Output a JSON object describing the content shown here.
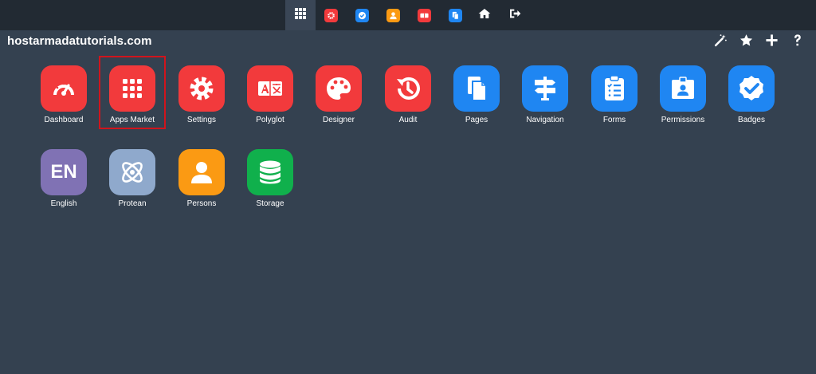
{
  "site_title": "hostarmadatutorials.com",
  "colors": {
    "red": "#f23a3c",
    "blue": "#1f86f2",
    "orange": "#fb9a13",
    "purple": "#8072b4",
    "lightblue": "#8fa9cc",
    "green": "#10b04c",
    "highlight": "#d0141c"
  },
  "topbar": {
    "items": [
      {
        "icon": "grid-icon"
      },
      {
        "icon": "settings-icon"
      },
      {
        "icon": "badge-check-icon"
      },
      {
        "icon": "person-icon"
      },
      {
        "icon": "polyglot-icon"
      },
      {
        "icon": "pages-icon"
      },
      {
        "icon": "home-icon"
      },
      {
        "icon": "logout-icon"
      }
    ]
  },
  "toolbar": {
    "items": [
      {
        "icon": "magic-wand-icon"
      },
      {
        "icon": "star-icon"
      },
      {
        "icon": "plus-icon"
      },
      {
        "icon": "help-icon"
      }
    ]
  },
  "apps": [
    {
      "label": "Dashboard",
      "icon": "dashboard-gauge-icon",
      "color": "red"
    },
    {
      "label": "Apps Market",
      "icon": "apps-grid-icon",
      "color": "red",
      "selected": true
    },
    {
      "label": "Settings",
      "icon": "gear-icon",
      "color": "red"
    },
    {
      "label": "Polyglot",
      "icon": "translate-icon",
      "color": "red"
    },
    {
      "label": "Designer",
      "icon": "palette-icon",
      "color": "red"
    },
    {
      "label": "Audit",
      "icon": "history-icon",
      "color": "red"
    },
    {
      "label": "Pages",
      "icon": "pages-icon",
      "color": "blue"
    },
    {
      "label": "Navigation",
      "icon": "signpost-icon",
      "color": "blue"
    },
    {
      "label": "Forms",
      "icon": "clipboard-list-icon",
      "color": "blue"
    },
    {
      "label": "Permissions",
      "icon": "id-badge-icon",
      "color": "blue"
    },
    {
      "label": "Badges",
      "icon": "badge-check-icon",
      "color": "blue"
    },
    {
      "label": "English",
      "icon": "en-text-icon",
      "color": "purple",
      "icon_text": "EN"
    },
    {
      "label": "Protean",
      "icon": "atom-icon",
      "color": "lightblue"
    },
    {
      "label": "Persons",
      "icon": "person-icon",
      "color": "orange"
    },
    {
      "label": "Storage",
      "icon": "database-icon",
      "color": "green"
    }
  ]
}
